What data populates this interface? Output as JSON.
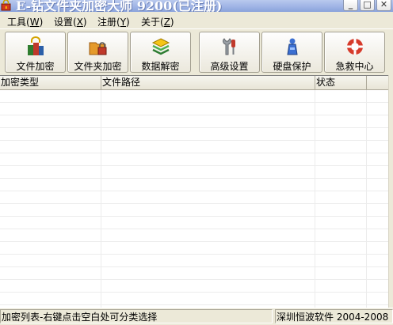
{
  "window": {
    "title": "E-钻文件夹加密大师 9200(已注册)"
  },
  "menu": [
    {
      "label": "工具(",
      "accel": "W",
      "close": ")"
    },
    {
      "label": "设置(",
      "accel": "X",
      "close": ")"
    },
    {
      "label": "注册(",
      "accel": "Y",
      "close": ")"
    },
    {
      "label": "关于(",
      "accel": "Z",
      "close": ")"
    }
  ],
  "toolbar": {
    "buttons": [
      {
        "label": "文件加密",
        "icon": "file-encrypt-icon"
      },
      {
        "label": "文件夹加密",
        "icon": "folder-lock-icon"
      },
      {
        "label": "数据解密",
        "icon": "data-decrypt-icon"
      },
      {
        "label": "高级设置",
        "icon": "wrench-settings-icon"
      },
      {
        "label": "硬盘保护",
        "icon": "disk-protect-icon"
      },
      {
        "label": "急救中心",
        "icon": "lifebuoy-icon"
      }
    ]
  },
  "list": {
    "columns": [
      "加密类型",
      "文件路径",
      "状态"
    ],
    "rows": []
  },
  "status": {
    "hint": "加密列表-右键点击空白处可分类选择",
    "copyright": "深圳恒波软件 2004-2008"
  },
  "colors": {
    "face": "#ece9d8",
    "title": "#9db2e4"
  }
}
